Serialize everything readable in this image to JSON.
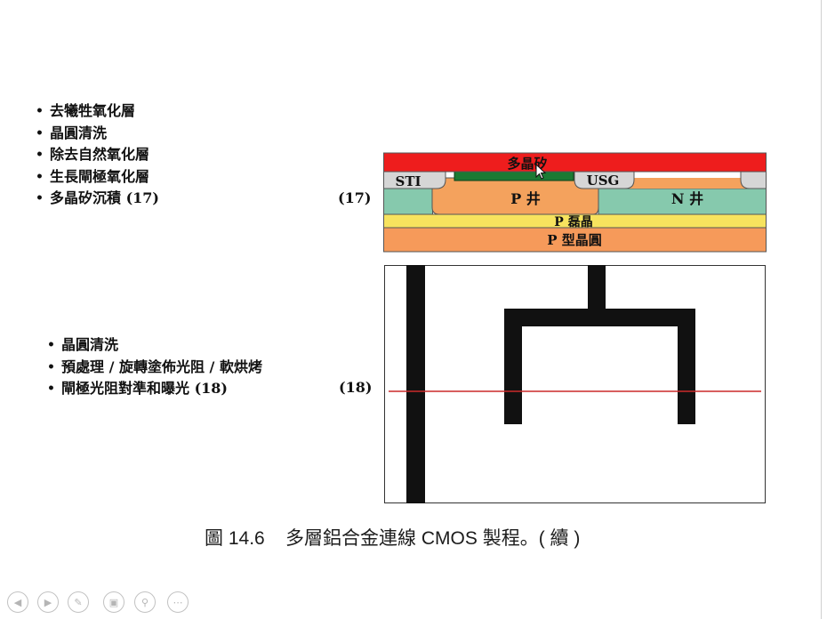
{
  "step17": {
    "bullets": [
      "去犧牲氧化層",
      "晶圓清洗",
      "除去自然氧化層",
      "生長閘極氧化層",
      "多晶矽沉積 (17)"
    ],
    "label": "(17)",
    "diagram": {
      "polysilicon": "多晶矽",
      "sti": "STI",
      "usg": "USG",
      "p_well": "P 井",
      "n_well": "N 井",
      "p_epi": "P 磊晶",
      "p_wafer": "P 型晶圓"
    }
  },
  "step18": {
    "bullets": [
      "晶圓清洗",
      "預處理 / 旋轉塗佈光阻 / 軟烘烤",
      "閘極光阻對準和曝光 (18)"
    ],
    "label": "(18)"
  },
  "caption": "圖 14.6    多層鋁合金連線 CMOS 製程。( 續 )",
  "colors": {
    "polysilicon": "#ee1d1d",
    "gate_oxide": "#1c7a33",
    "sti_oxide": "#d6d6d6",
    "p_well": "#f4a25d",
    "n_well": "#86c9ad",
    "p_epi": "#f7e35e",
    "p_wafer": "#f69a5a",
    "mask_line": "#cc2a2a"
  },
  "toolbar": {
    "icons": [
      "prev-icon",
      "next-icon",
      "pen-icon",
      "slides-icon",
      "zoom-icon",
      "more-icon"
    ]
  }
}
